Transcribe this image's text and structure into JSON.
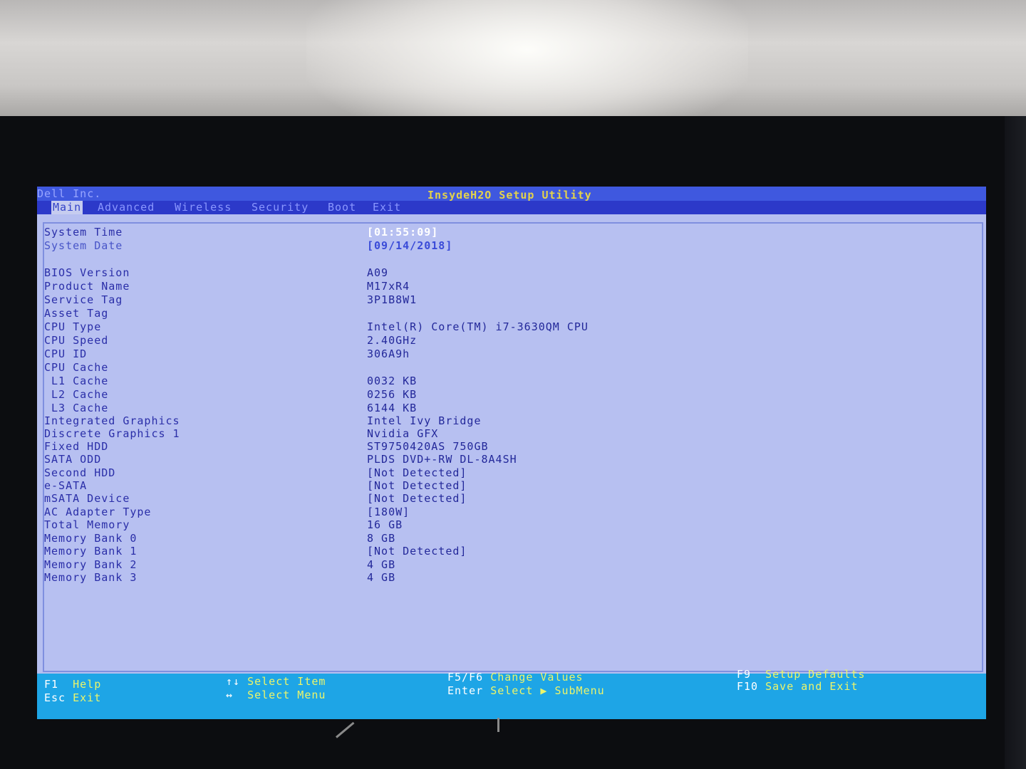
{
  "vendor": "Dell Inc.",
  "utility_title": "InsydeH2O Setup Utility",
  "menu": [
    {
      "label": "Main",
      "active": true
    },
    {
      "label": "Advanced",
      "active": false
    },
    {
      "label": "Wireless",
      "active": false
    },
    {
      "label": "Security",
      "active": false
    },
    {
      "label": "Boot",
      "active": false
    },
    {
      "label": "Exit",
      "active": false
    }
  ],
  "system": {
    "time_label": "System Time",
    "time_value": "[01:55:09]",
    "date_label": "System Date",
    "date_value": "[09/14/2018]"
  },
  "info": [
    {
      "label": "BIOS Version",
      "value": "A09"
    },
    {
      "label": "Product Name",
      "value": "M17xR4"
    },
    {
      "label": "Service Tag",
      "value": "3P1B8W1"
    },
    {
      "label": "Asset Tag",
      "value": ""
    },
    {
      "label": "CPU Type",
      "value": "Intel(R) Core(TM) i7-3630QM CPU"
    },
    {
      "label": "CPU Speed",
      "value": "2.40GHz"
    },
    {
      "label": "CPU ID",
      "value": "306A9h"
    },
    {
      "label": "CPU Cache",
      "value": ""
    },
    {
      "label": " L1 Cache",
      "value": "0032 KB"
    },
    {
      "label": " L2 Cache",
      "value": "0256 KB"
    },
    {
      "label": " L3 Cache",
      "value": "6144 KB"
    },
    {
      "label": "Integrated Graphics",
      "value": "Intel Ivy Bridge"
    },
    {
      "label": "Discrete Graphics 1",
      "value": "Nvidia GFX"
    },
    {
      "label": "Fixed HDD",
      "value": "ST9750420AS 750GB"
    },
    {
      "label": "SATA ODD",
      "value": "PLDS DVD+-RW DL-8A4SH"
    },
    {
      "label": "Second HDD",
      "value": "[Not Detected]"
    },
    {
      "label": "e-SATA",
      "value": "[Not Detected]"
    },
    {
      "label": "mSATA Device",
      "value": "[Not Detected]"
    },
    {
      "label": "AC Adapter Type",
      "value": "[180W]"
    },
    {
      "label": "Total Memory",
      "value": "16 GB"
    },
    {
      "label": "Memory Bank 0",
      "value": "8 GB"
    },
    {
      "label": "Memory Bank 1",
      "value": "[Not Detected]"
    },
    {
      "label": "Memory Bank 2",
      "value": "4 GB"
    },
    {
      "label": "Memory Bank 3",
      "value": "4 GB"
    }
  ],
  "footer": {
    "f1_key": "F1",
    "f1_desc": "Help",
    "esc_key": "Esc",
    "esc_desc": "Exit",
    "updown_key": "↑↓",
    "updown_desc": "Select Item",
    "leftright_key": "↔",
    "leftright_desc": "Select Menu",
    "f5f6_key": "F5/F6",
    "f5f6_desc": "Change Values",
    "enter_key": "Enter",
    "enter_desc": "Select ▶ SubMenu",
    "f9_key": "F9",
    "f9_desc": "Setup Defaults",
    "f10_key": "F10",
    "f10_desc": "Save and Exit"
  },
  "colors": {
    "screen_bg": "#b6bff0",
    "title_bar": "#3f58df",
    "menu_bar": "#2c39c9",
    "footer_bar": "#1ea5e6",
    "label_text": "#2a2ea8",
    "title_text": "#e4d34a"
  }
}
